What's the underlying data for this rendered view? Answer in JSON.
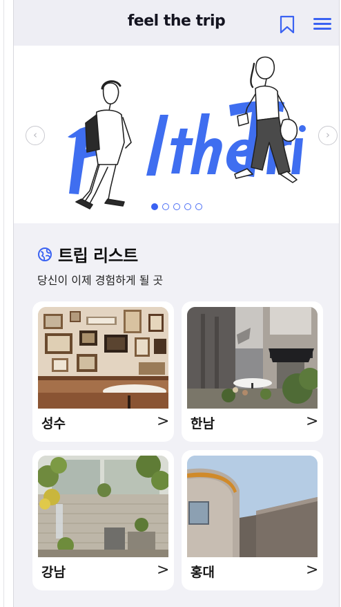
{
  "header": {
    "logo": "feel the trip",
    "bookmark_icon": "bookmark-icon",
    "menu_icon": "hamburger-menu-icon"
  },
  "banner": {
    "headline": "Fel the Trip",
    "prev_icon": "chevron-left-icon",
    "next_icon": "chevron-right-icon",
    "slide_count": 5,
    "active_slide": 1
  },
  "trip_list": {
    "icon": "globe-icon",
    "title": "트립 리스트",
    "subtitle": "당신이 이제 경험하게 될 곳",
    "cards": [
      {
        "name": "성수",
        "chevron": ">"
      },
      {
        "name": "한남",
        "chevron": ">"
      },
      {
        "name": "강남",
        "chevron": ">"
      },
      {
        "name": "홍대",
        "chevron": ">"
      }
    ]
  },
  "colors": {
    "accent": "#3a62f2",
    "page_bg": "#f1f1f6",
    "card_bg": "#ffffff"
  }
}
